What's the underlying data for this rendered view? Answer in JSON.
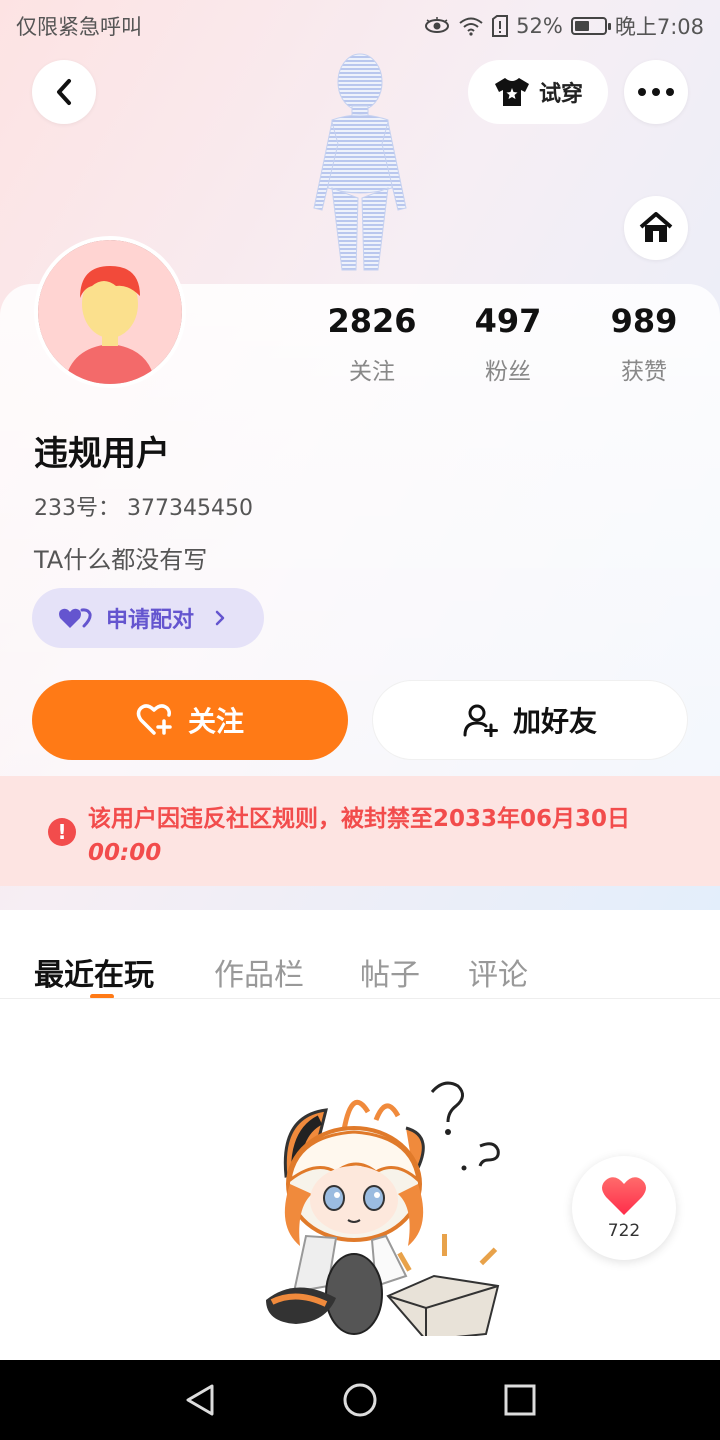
{
  "status_bar": {
    "carrier": "仅限紧急呼叫",
    "battery": "52%",
    "battery_level": 0.52,
    "time": "晚上7:08"
  },
  "header": {
    "try_on_label": "试穿"
  },
  "profile": {
    "stats": [
      {
        "value": "2826",
        "label": "关注"
      },
      {
        "value": "497",
        "label": "粉丝"
      },
      {
        "value": "989",
        "label": "获赞"
      }
    ],
    "username": "违规用户",
    "id_text": "233号： 377345450",
    "bio": "TA什么都没有写",
    "pair_label": "申请配对"
  },
  "actions": {
    "follow_label": "关注",
    "add_friend_label": "加好友"
  },
  "ban_notice": {
    "text": "该用户因违反社区规则，被封禁至2033年06月30日",
    "time": "00:00"
  },
  "tabs": [
    {
      "label": "最近在玩",
      "active": true
    },
    {
      "label": "作品栏",
      "active": false
    },
    {
      "label": "帖子",
      "active": false
    },
    {
      "label": "评论",
      "active": false
    }
  ],
  "like_fab": {
    "count": "722"
  },
  "colors": {
    "accent": "#ff7a16",
    "ban_red": "#f24c4c",
    "pair_purple": "#6455cf"
  }
}
